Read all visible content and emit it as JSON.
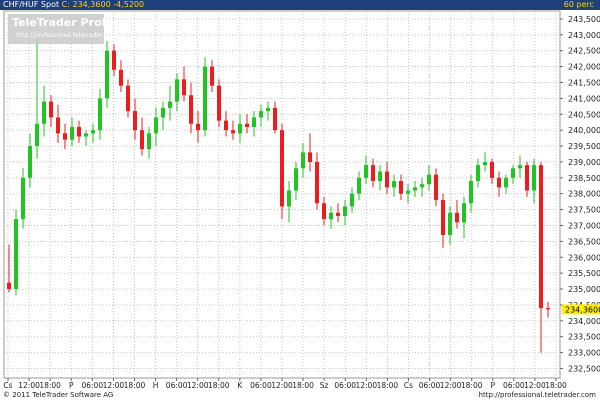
{
  "header": {
    "instrument": "CHF/HUF Spot",
    "close_label": "C: 234,3600",
    "change": "-4,5200",
    "interval": "60 perc"
  },
  "branding": {
    "name": "TeleTrader Professional",
    "url": "http://professional.teletrader.com"
  },
  "footer": {
    "copyright": "© 2011 TeleTrader Software AG",
    "url": "http://professional.teletrader.com"
  },
  "colors": {
    "up": "#22c422",
    "down": "#ee1c1c",
    "header_bg": "#1f3f7a",
    "last_price_bg": "#ffee00"
  },
  "chart_data": {
    "type": "candlestick",
    "title": "CHF/HUF Spot",
    "ylim": [
      232.2,
      243.75
    ],
    "y_ticks": [
      "232,5000",
      "233,0000",
      "233,5000",
      "234,0000",
      "234,5000",
      "235,0000",
      "235,5000",
      "236,0000",
      "236,5000",
      "237,0000",
      "237,5000",
      "238,0000",
      "238,5000",
      "239,0000",
      "239,5000",
      "240,0000",
      "240,5000",
      "241,0000",
      "241,5000",
      "242,0000",
      "242,5000",
      "243,0000",
      "243,5000"
    ],
    "last_price": "234,3600",
    "x_ticks": [
      "Cs",
      "12:00",
      "18:00",
      "P",
      "06:00",
      "12:00",
      "18:00",
      "H",
      "06:00",
      "12:00",
      "18:00",
      "K",
      "06:00",
      "12:00",
      "18:00",
      "Sz",
      "06:00",
      "12:00",
      "18:00",
      "Cs",
      "06:00",
      "12:00",
      "18:00",
      "P",
      "06:00",
      "12:00",
      "18:00"
    ],
    "candles": [
      [
        235.2,
        236.4,
        234.9,
        235.0
      ],
      [
        235.0,
        237.5,
        234.8,
        237.2
      ],
      [
        237.2,
        238.8,
        236.9,
        238.5
      ],
      [
        238.5,
        239.9,
        238.2,
        239.5
      ],
      [
        239.5,
        243.0,
        239.1,
        240.2
      ],
      [
        240.2,
        241.4,
        239.8,
        240.9
      ],
      [
        240.9,
        241.1,
        240.1,
        240.4
      ],
      [
        240.4,
        240.8,
        239.6,
        239.9
      ],
      [
        239.9,
        240.2,
        239.4,
        239.7
      ],
      [
        239.7,
        240.4,
        239.5,
        240.1
      ],
      [
        240.1,
        240.3,
        239.6,
        239.8
      ],
      [
        239.8,
        240.0,
        239.5,
        239.9
      ],
      [
        239.9,
        240.2,
        239.6,
        240.0
      ],
      [
        240.0,
        241.3,
        239.7,
        241.0
      ],
      [
        241.0,
        242.8,
        240.7,
        242.5
      ],
      [
        242.5,
        242.7,
        241.7,
        241.9
      ],
      [
        241.9,
        242.2,
        241.2,
        241.4
      ],
      [
        241.4,
        241.6,
        240.4,
        240.6
      ],
      [
        240.6,
        241.0,
        239.7,
        240.0
      ],
      [
        240.0,
        240.4,
        239.2,
        239.4
      ],
      [
        239.4,
        240.1,
        239.1,
        239.9
      ],
      [
        239.9,
        240.7,
        239.5,
        240.4
      ],
      [
        240.4,
        240.9,
        240.0,
        240.7
      ],
      [
        240.7,
        241.4,
        240.3,
        240.9
      ],
      [
        240.9,
        241.8,
        240.6,
        241.6
      ],
      [
        241.6,
        242.0,
        240.9,
        241.1
      ],
      [
        241.1,
        241.5,
        239.9,
        240.2
      ],
      [
        240.2,
        240.6,
        239.6,
        240.0
      ],
      [
        240.0,
        242.3,
        239.8,
        242.0
      ],
      [
        242.0,
        242.2,
        241.2,
        241.4
      ],
      [
        241.4,
        241.6,
        240.1,
        240.3
      ],
      [
        240.3,
        240.6,
        239.8,
        240.0
      ],
      [
        240.0,
        240.3,
        239.7,
        239.9
      ],
      [
        239.9,
        240.5,
        239.6,
        240.2
      ],
      [
        240.2,
        240.5,
        239.9,
        240.1
      ],
      [
        240.1,
        240.6,
        239.8,
        240.4
      ],
      [
        240.4,
        240.8,
        240.1,
        240.6
      ],
      [
        240.6,
        240.9,
        240.3,
        240.7
      ],
      [
        240.7,
        240.9,
        239.9,
        240.0
      ],
      [
        240.0,
        240.2,
        237.2,
        237.6
      ],
      [
        237.6,
        238.4,
        237.1,
        238.1
      ],
      [
        238.1,
        239.0,
        237.8,
        238.8
      ],
      [
        238.8,
        239.6,
        238.5,
        239.3
      ],
      [
        239.3,
        239.9,
        238.7,
        239.0
      ],
      [
        239.0,
        239.3,
        237.5,
        237.7
      ],
      [
        237.7,
        237.9,
        237.0,
        237.2
      ],
      [
        237.2,
        237.6,
        236.9,
        237.4
      ],
      [
        237.4,
        237.7,
        237.1,
        237.3
      ],
      [
        237.3,
        237.8,
        237.0,
        237.6
      ],
      [
        237.6,
        238.2,
        237.4,
        238.0
      ],
      [
        238.0,
        238.7,
        237.8,
        238.5
      ],
      [
        238.5,
        239.2,
        238.3,
        238.9
      ],
      [
        238.9,
        239.1,
        238.2,
        238.4
      ],
      [
        238.4,
        238.9,
        238.1,
        238.7
      ],
      [
        238.7,
        239.0,
        238.0,
        238.2
      ],
      [
        238.2,
        238.6,
        237.9,
        238.4
      ],
      [
        238.4,
        238.6,
        237.8,
        238.0
      ],
      [
        238.0,
        238.3,
        237.7,
        238.1
      ],
      [
        238.1,
        238.4,
        237.9,
        238.2
      ],
      [
        238.2,
        238.5,
        237.9,
        238.3
      ],
      [
        238.3,
        238.9,
        238.1,
        238.6
      ],
      [
        238.6,
        238.8,
        237.6,
        237.8
      ],
      [
        237.8,
        238.0,
        236.3,
        236.7
      ],
      [
        236.7,
        237.6,
        236.4,
        237.4
      ],
      [
        237.4,
        237.8,
        236.9,
        237.1
      ],
      [
        237.1,
        237.9,
        236.6,
        237.7
      ],
      [
        237.7,
        238.6,
        237.4,
        238.4
      ],
      [
        238.4,
        239.1,
        238.2,
        238.9
      ],
      [
        238.9,
        239.3,
        238.7,
        239.0
      ],
      [
        239.0,
        239.1,
        238.3,
        238.5
      ],
      [
        238.5,
        238.7,
        237.9,
        238.2
      ],
      [
        238.2,
        238.6,
        238.0,
        238.5
      ],
      [
        238.5,
        238.9,
        238.3,
        238.8
      ],
      [
        238.8,
        239.2,
        238.5,
        238.9
      ],
      [
        238.9,
        239.0,
        237.9,
        238.1
      ],
      [
        238.1,
        239.1,
        237.7,
        238.9
      ],
      [
        238.9,
        239.0,
        233.0,
        234.4
      ],
      [
        234.4,
        234.6,
        234.1,
        234.36
      ]
    ]
  }
}
